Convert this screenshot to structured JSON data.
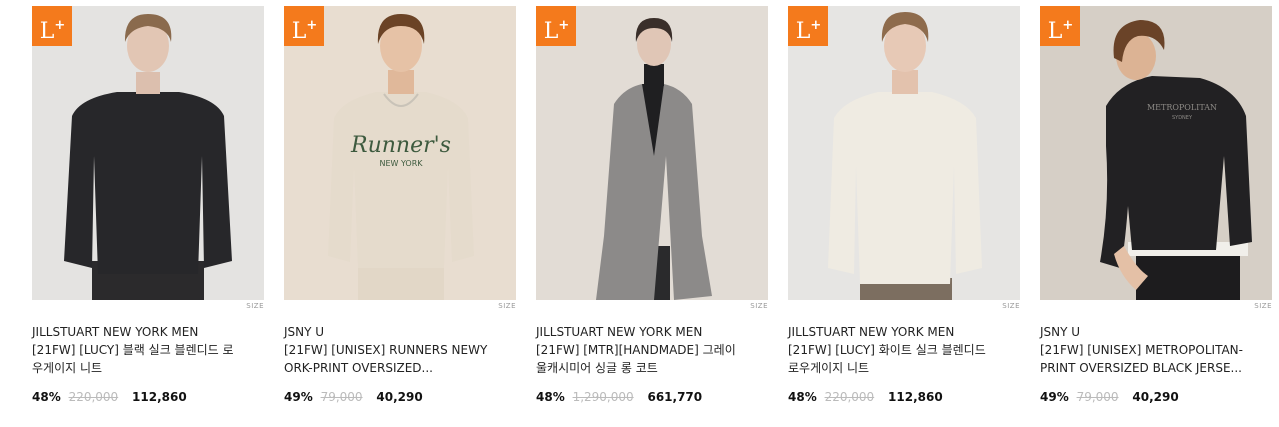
{
  "products": [
    {
      "badge": "L",
      "size_tag": "SIZE",
      "brand": "JILLSTUART NEW YORK MEN",
      "name": "[21FW] [LUCY] 블랙 실크 블렌디드 로우게이지 니트",
      "discount": "48%",
      "original_price": "220,000",
      "sale_price": "112,860",
      "garment": "black-sweater",
      "colors": {
        "bg": "#e4e3e1",
        "garment": "#27272a",
        "pants": "#2b2a2c"
      }
    },
    {
      "badge": "L",
      "size_tag": "SIZE",
      "brand": "JSNY U",
      "name": "[21FW] [UNISEX] RUNNERS NEWYORK-PRINT OVERSIZED...",
      "discount": "49%",
      "original_price": "79,000",
      "sale_price": "40,290",
      "garment": "runners-sweatshirt",
      "print_text": [
        "Runner's",
        "NEW YORK"
      ],
      "colors": {
        "bg": "#e8ddd0",
        "garment": "#e5dbcc",
        "pants": "#e2d7c7",
        "print": "#3d5a3e"
      }
    },
    {
      "badge": "L",
      "size_tag": "SIZE",
      "brand": "JILLSTUART NEW YORK MEN",
      "name": "[21FW] [MTR][HANDMADE] 그레이 울캐시미어 싱글 롱 코트",
      "discount": "48%",
      "original_price": "1,290,000",
      "sale_price": "661,770",
      "garment": "grey-coat",
      "colors": {
        "bg": "#e2dcd5",
        "garment": "#8c8a89",
        "pants": "#2a2a2c"
      }
    },
    {
      "badge": "L",
      "size_tag": "SIZE",
      "brand": "JILLSTUART NEW YORK MEN",
      "name": "[21FW] [LUCY] 화이트 실크 블렌디드 로우게이지 니트",
      "discount": "48%",
      "original_price": "220,000",
      "sale_price": "112,860",
      "garment": "white-sweater",
      "colors": {
        "bg": "#e6e5e3",
        "garment": "#efebe2",
        "pants": "#7c6e60"
      }
    },
    {
      "badge": "L",
      "size_tag": "SIZE",
      "brand": "JSNY U",
      "name": "[21FW] [UNISEX] METROPOLITAN-PRINT OVERSIZED BLACK JERSE...",
      "discount": "49%",
      "original_price": "79,000",
      "sale_price": "40,290",
      "garment": "metropolitan-sweatshirt",
      "print_text": [
        "METROPOLITAN",
        "SYDNEY"
      ],
      "colors": {
        "bg": "#d6cfc6",
        "garment": "#222123",
        "pants": "#1d1c1e"
      }
    }
  ],
  "accent": "#f47a1c"
}
